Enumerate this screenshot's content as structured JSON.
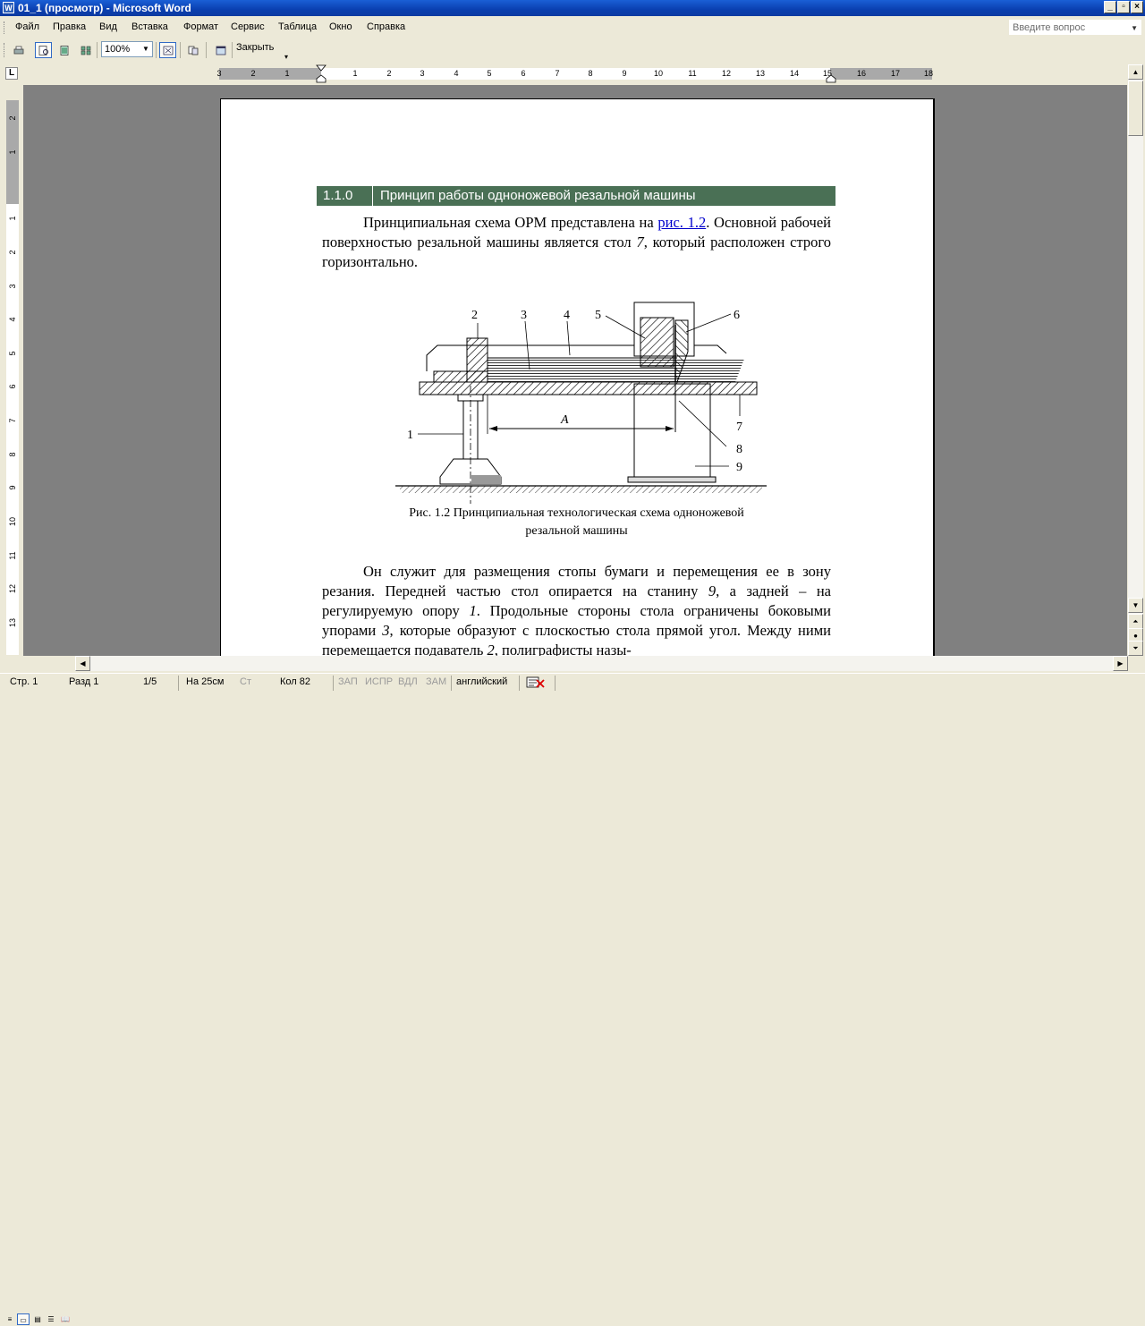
{
  "window": {
    "title": "01_1 (просмотр) - Microsoft Word",
    "app_icon": "W"
  },
  "window_buttons": [
    "_",
    "▫",
    "×"
  ],
  "menu": [
    "Файл",
    "Правка",
    "Вид",
    "Вставка",
    "Формат",
    "Сервис",
    "Таблица",
    "Окно",
    "Справка"
  ],
  "ask_question": {
    "placeholder": "Введите вопрос"
  },
  "toolbar": {
    "zoom": "100%",
    "close_label": "Закрыть"
  },
  "tab_selector": "L",
  "hruler_ticks": [
    "3",
    "2",
    "1",
    "1",
    "2",
    "3",
    "4",
    "5",
    "6",
    "7",
    "8",
    "9",
    "10",
    "11",
    "12",
    "13",
    "14",
    "15",
    "16",
    "17",
    "18"
  ],
  "vruler_ticks": [
    "2",
    "1",
    "1",
    "2",
    "3",
    "4",
    "5",
    "6",
    "7",
    "8",
    "9",
    "10",
    "11",
    "12",
    "13"
  ],
  "document": {
    "heading_number": "1.1.0",
    "heading_text": "Принцип работы одноножевой резальной машины",
    "p1_a": "Принципиальная схема ОРМ представлена на ",
    "p1_link": "рис. 1.2",
    "p1_b": ". Основной рабочей поверхностью резальной машины является стол ",
    "p1_num": "7",
    "p1_c": ", который расположен   строго горизонтально.",
    "figure_labels": [
      "1",
      "2",
      "3",
      "4",
      "5",
      "6",
      "7",
      "8",
      "9",
      "A"
    ],
    "caption_line1": "Рис. 1.2  Принципиальная технологическая схема одноножевой",
    "caption_line2": "резальной машины",
    "p2_a": "Он служит для размещения стопы бумаги и перемещения ее в зону резания. Передней частью стол опирается на станину ",
    "p2_n9": "9",
    "p2_b": ", а задней – на регулируемую опору ",
    "p2_n1": "1",
    "p2_c": ". Продольные стороны стола ограничены боковыми упорами ",
    "p2_n3": "3",
    "p2_d": ", которые образуют с плоскостью стола прямой угол. Между ними перемещается подаватель ",
    "p2_n2": "2",
    "p2_e": ", полиграфисты назы-"
  },
  "status": {
    "page": "Стр. 1",
    "section": "Разд 1",
    "pages": "1/5",
    "at": "На 25см",
    "line": "Ст",
    "col": "Кол 82",
    "rec": "ЗАП",
    "trk": "ИСПР",
    "ext": "ВДЛ",
    "ovr": "ЗАМ",
    "lang": "английский"
  }
}
